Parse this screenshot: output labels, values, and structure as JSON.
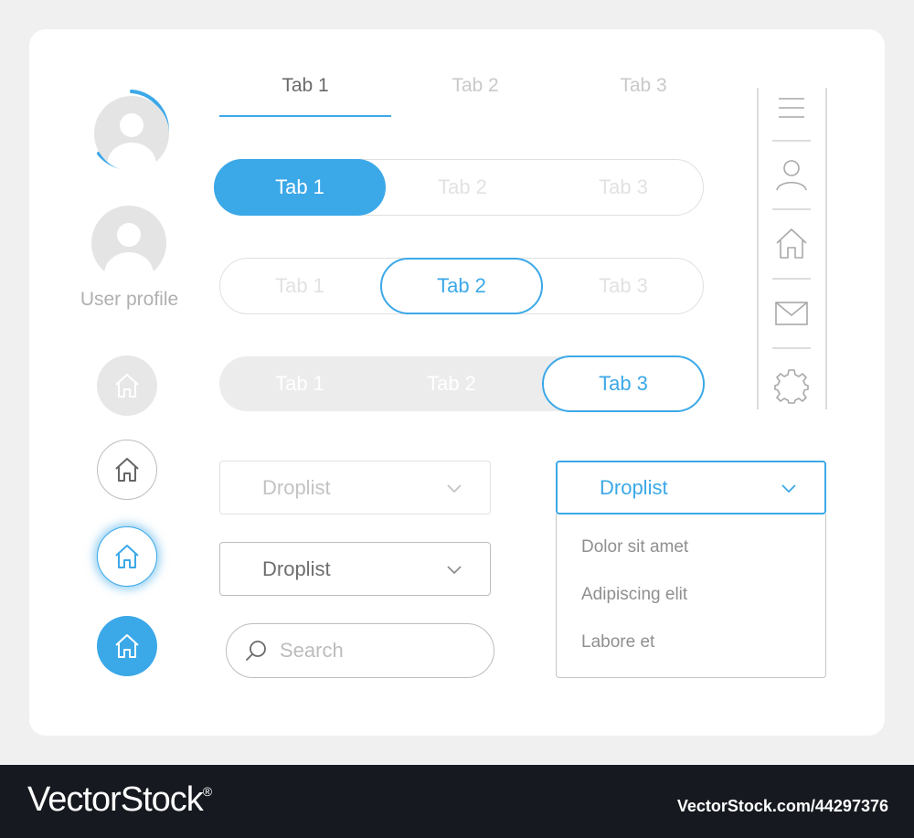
{
  "profile": {
    "label": "User profile"
  },
  "underline_tabs": {
    "items": [
      "Tab 1",
      "Tab 2",
      "Tab 3"
    ],
    "active": 0
  },
  "pill_tabs_filled": {
    "items": [
      "Tab 1",
      "Tab 2",
      "Tab 3"
    ],
    "active": 0
  },
  "pill_tabs_outline": {
    "items": [
      "Tab 1",
      "Tab 2",
      "Tab 3"
    ],
    "active": 1
  },
  "pill_tabs_gray": {
    "items": [
      "Tab 1",
      "Tab 2",
      "Tab 3"
    ],
    "active": 2
  },
  "droplists": {
    "disabled": {
      "label": "Droplist"
    },
    "default": {
      "label": "Droplist"
    },
    "open": {
      "label": "Droplist",
      "options": [
        "Dolor sit amet",
        "Adipiscing elit",
        "Labore et"
      ]
    }
  },
  "search": {
    "placeholder": "Search"
  },
  "icons": {
    "avatar": "user-avatar-icon",
    "home": "home-icon",
    "menu": "hamburger-menu-icon",
    "user": "user-icon",
    "mail": "mail-icon",
    "settings": "gear-icon",
    "chevron": "chevron-down-icon",
    "search": "search-icon"
  },
  "colors": {
    "accent": "#3ba8e8",
    "muted": "#c8c8c8",
    "text": "#777777"
  },
  "footer": {
    "brand": "VectorStock",
    "trademark": "®",
    "credit": "VectorStock.com/44297376"
  }
}
